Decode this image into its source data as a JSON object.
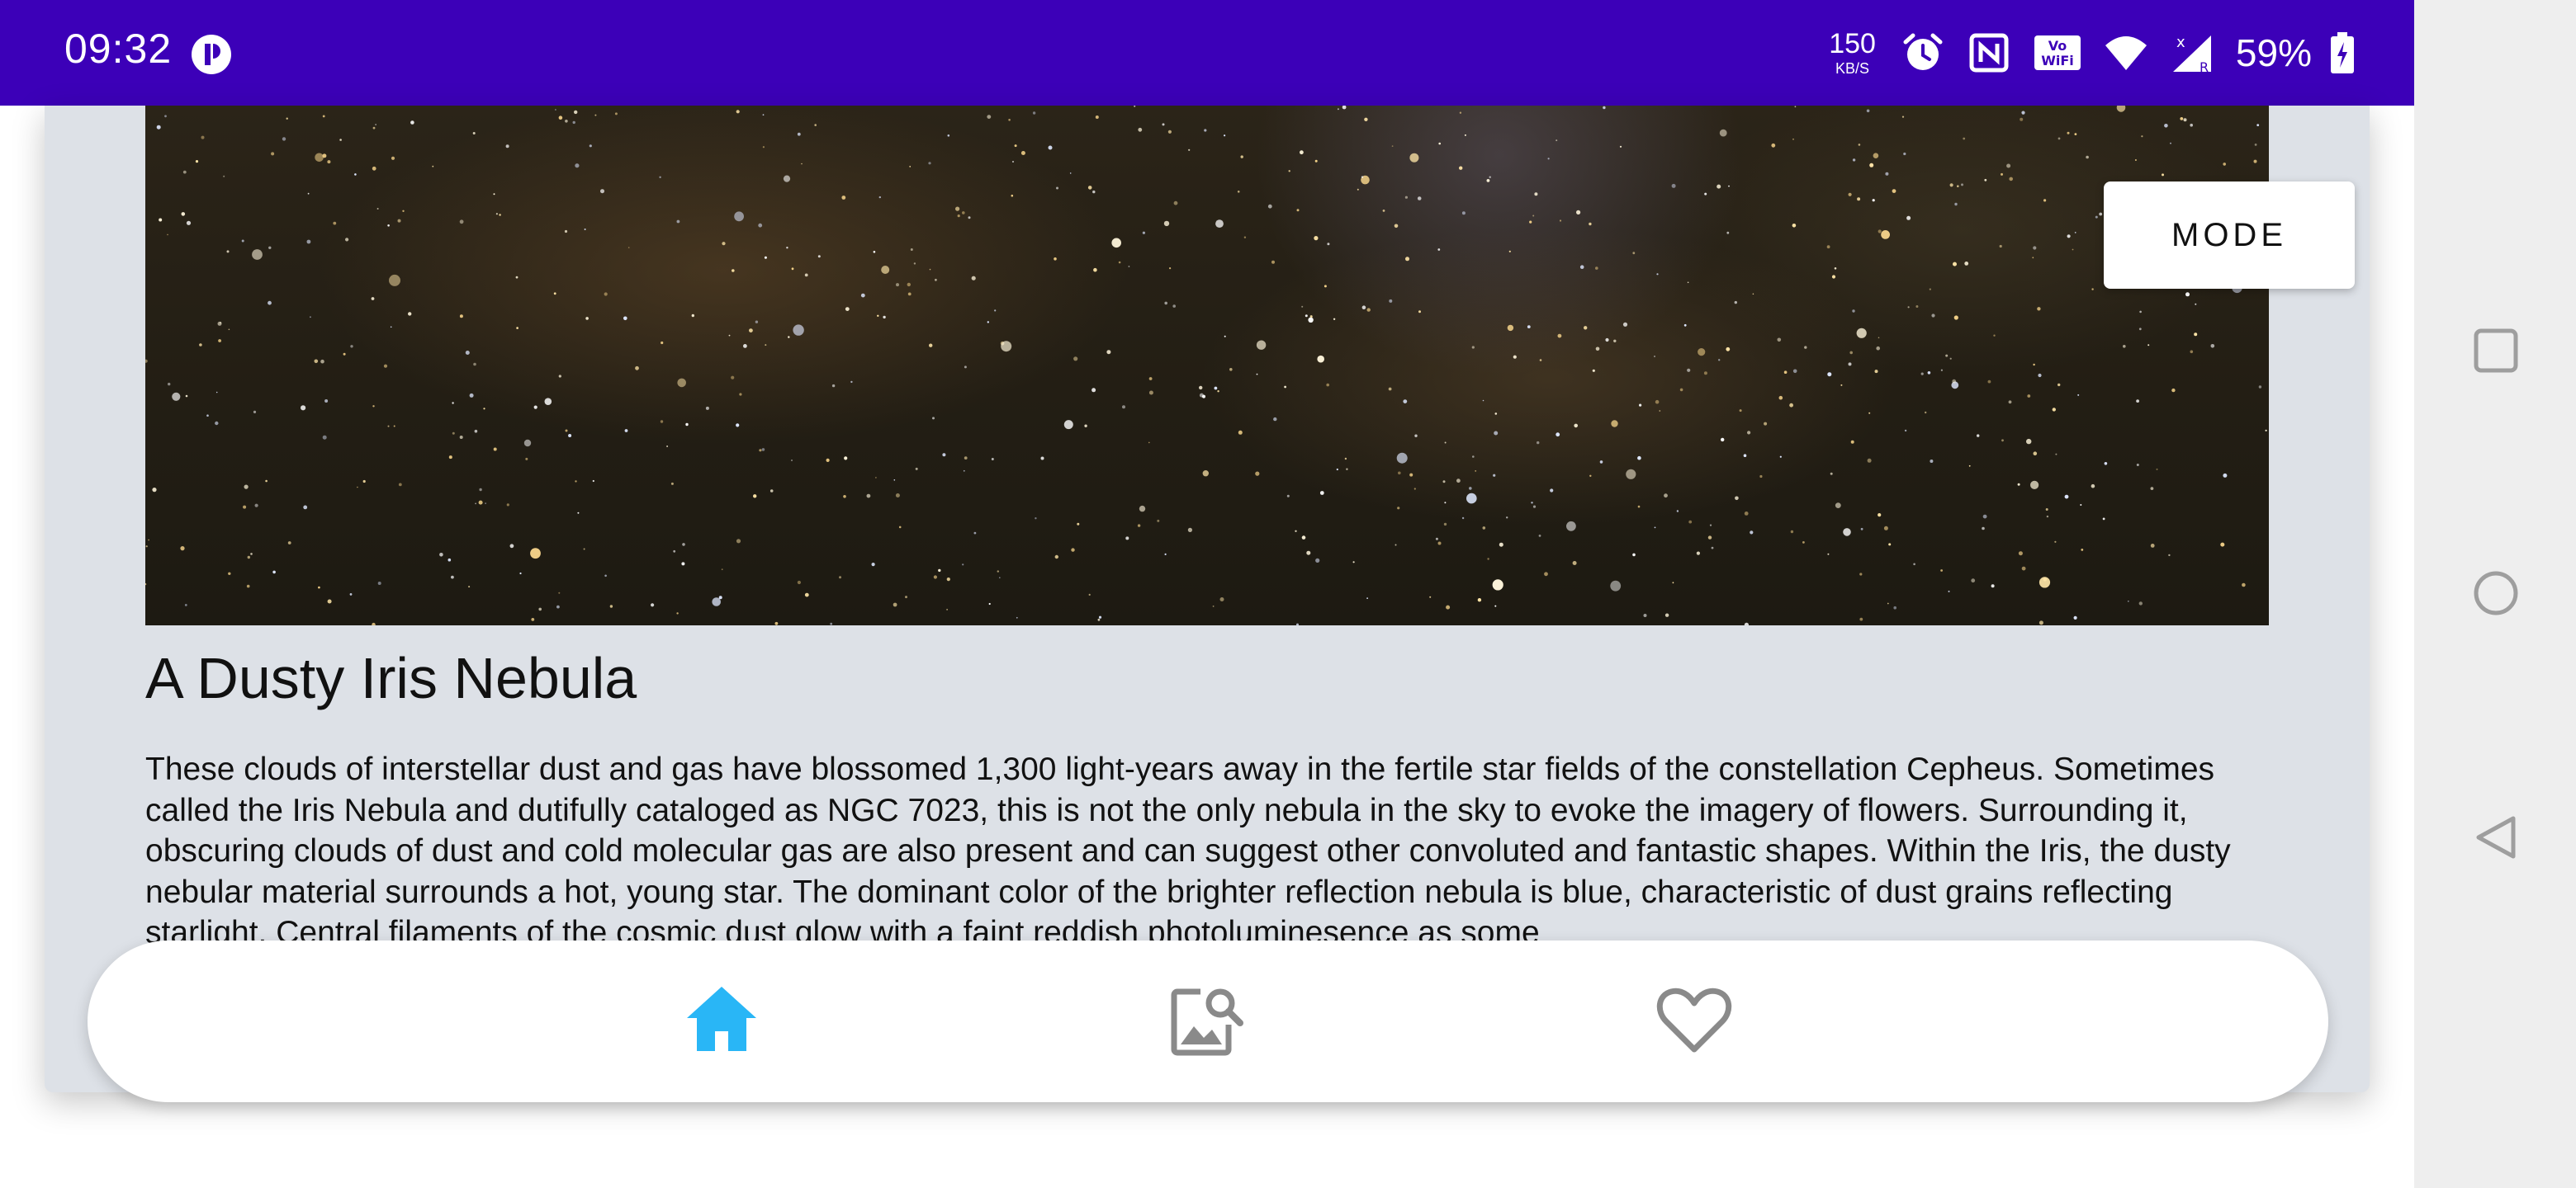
{
  "status_bar": {
    "time": "09:32",
    "speed_value": "150",
    "speed_unit": "KB/S",
    "battery": "59%",
    "icons": [
      "alarm-icon",
      "nfc-icon",
      "vowifi-icon",
      "wifi-icon",
      "signal-icon",
      "battery-charging-icon"
    ]
  },
  "apod": {
    "mode_label": "MODE",
    "title": "A Dusty Iris Nebula",
    "explanation": "These clouds of interstellar dust and gas have blossomed 1,300 light-years away in the fertile star fields of the constellation Cepheus. Sometimes called the Iris Nebula and dutifully cataloged as NGC 7023, this is not the only nebula in the sky to evoke the imagery of flowers. Surrounding it, obscuring clouds of dust and cold molecular gas are also present and can suggest other convoluted and fantastic shapes. Within the Iris, the dusty nebular material surrounds a hot, young star. The dominant color of the brighter reflection nebula is blue, characteristic of dust grains reflecting starlight. Central filaments of the cosmic dust glow with a faint reddish photoluminesence as some"
  },
  "bottom_nav": {
    "items": [
      {
        "icon": "home-icon",
        "active": true
      },
      {
        "icon": "image-search-icon",
        "active": false
      },
      {
        "icon": "heart-icon",
        "active": false
      }
    ],
    "active_color": "#29b6f6",
    "inactive_color": "#8a8a8a"
  },
  "colors": {
    "status_bar": "#3c00b8",
    "card_background": "#dde1e7"
  }
}
